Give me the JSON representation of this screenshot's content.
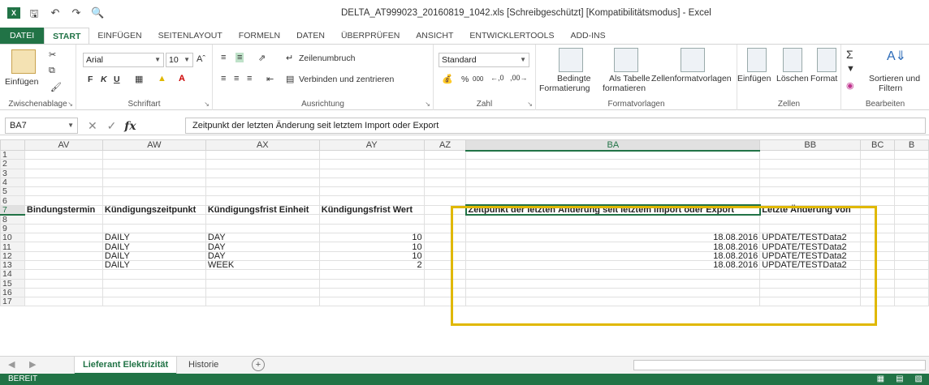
{
  "app": {
    "logo_text": "X",
    "window_title": "DELTA_AT999023_20160819_1042.xls  [Schreibgeschützt]  [Kompatibilitätsmodus] - Excel"
  },
  "qat": {
    "save_icon": "save-icon",
    "undo_icon": "undo-icon",
    "redo_icon": "redo-icon",
    "preview_icon": "print-preview-icon"
  },
  "ribbon_tabs": [
    "DATEI",
    "START",
    "EINFÜGEN",
    "SEITENLAYOUT",
    "FORMELN",
    "DATEN",
    "ÜBERPRÜFEN",
    "ANSICHT",
    "ENTWICKLERTOOLS",
    "ADD-INS"
  ],
  "ribbon": {
    "clipboard": {
      "paste_label": "Einfügen",
      "group_label": "Zwischenablage"
    },
    "font": {
      "font_name": "Arial",
      "font_size": "10",
      "bold": "F",
      "italic": "K",
      "underline": "U",
      "group_label": "Schriftart"
    },
    "alignment": {
      "wrap_label": "Zeilenumbruch",
      "merge_label": "Verbinden und zentrieren",
      "group_label": "Ausrichtung"
    },
    "number": {
      "format": "Standard",
      "percent": "%",
      "thousands": "000",
      "group_label": "Zahl"
    },
    "styles": {
      "cond_format_line1": "Bedingte",
      "cond_format_line2": "Formatierung",
      "as_table_line1": "Als Tabelle",
      "as_table_line2": "formatieren",
      "cell_styles": "Zellenformatvorlagen",
      "group_label": "Formatvorlagen"
    },
    "cells": {
      "insert": "Einfügen",
      "delete": "Löschen",
      "format": "Format",
      "group_label": "Zellen"
    },
    "editing": {
      "sort_line1": "Sortieren und",
      "sort_line2": "Filtern",
      "group_label": "Bearbeiten"
    }
  },
  "formula_bar": {
    "name_box": "BA7",
    "fx_label": "fx",
    "formula": "Zeitpunkt der letzten Änderung seit letztem Import oder Export"
  },
  "grid": {
    "columns": [
      "AV",
      "AW",
      "AX",
      "AY",
      "AZ",
      "BA",
      "BB",
      "BC",
      "B"
    ],
    "rows": [
      "1",
      "2",
      "3",
      "4",
      "5",
      "6",
      "7",
      "8",
      "9",
      "10",
      "11",
      "12",
      "13",
      "14",
      "15",
      "16",
      "17"
    ],
    "headers_row7": {
      "AV": "Bindungstermin",
      "AW": "Kündigungszeitpunkt",
      "AX": "Kündigungsfrist Einheit",
      "AY": "Kündigungsfrist Wert",
      "BA": "Zeitpunkt der letzten Änderung seit letztem Import oder Export",
      "BB": "Letzte Änderung von"
    },
    "data_rows": [
      {
        "row": "10",
        "AW": "DAILY",
        "AX": "DAY",
        "AY": "10",
        "BA": "18.08.2016",
        "BB": "UPDATE/TESTData2"
      },
      {
        "row": "11",
        "AW": "DAILY",
        "AX": "DAY",
        "AY": "10",
        "BA": "18.08.2016",
        "BB": "UPDATE/TESTData2"
      },
      {
        "row": "12",
        "AW": "DAILY",
        "AX": "DAY",
        "AY": "10",
        "BA": "18.08.2016",
        "BB": "UPDATE/TESTData2"
      },
      {
        "row": "13",
        "AW": "DAILY",
        "AX": "WEEK",
        "AY": "2",
        "BA": "18.08.2016",
        "BB": "UPDATE/TESTData2"
      }
    ]
  },
  "sheet_tabs": {
    "active": "Lieferant Elektrizität",
    "other": "Historie",
    "add": "+"
  },
  "status": {
    "ready": "BEREIT"
  },
  "colors": {
    "excel_green": "#217346",
    "highlight_box": "#e0b800"
  }
}
